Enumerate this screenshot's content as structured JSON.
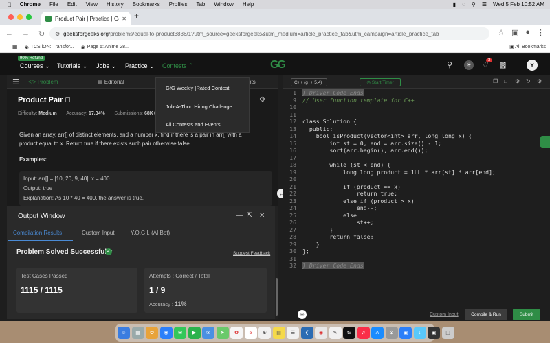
{
  "menubar": {
    "app": "Chrome",
    "items": [
      "File",
      "Edit",
      "View",
      "History",
      "Bookmarks",
      "Profiles",
      "Tab",
      "Window",
      "Help"
    ],
    "datetime": "Wed 5 Feb  10:52 AM"
  },
  "browser": {
    "tab_title": "Product Pair | Practice | Geek",
    "url_site": "geeksforgeeks.org",
    "url_rest": "/problems/equal-to-product3836/1?utm_source=geeksforgeeks&utm_medium=article_practice_tab&utm_campaign=article_practice_tab",
    "bookmarks": [
      {
        "label": "TCS iON: Transfor..."
      },
      {
        "label": "Page 5: Anime 28..."
      }
    ],
    "all_bookmarks": "All Bookmarks"
  },
  "gfg_nav": {
    "badge": "90% Refund",
    "items": [
      "Courses",
      "Tutorials",
      "Jobs",
      "Practice",
      "Contests"
    ],
    "logo_text": "GG",
    "notification_count": "3",
    "avatar_initial": "Y"
  },
  "problem_tabs": {
    "problem": "</> Problem",
    "editorial": "Editorial",
    "comments": "ments"
  },
  "problem": {
    "title": "Product Pair",
    "difficulty_label": "Difficulty:",
    "difficulty": "Medium",
    "accuracy_label": "Accuracy:",
    "accuracy": "17.34%",
    "submissions_label": "Submissions:",
    "submissions": "68K+",
    "desc_line1": "Given an array, arr[] of distinct elements, and a number x, find if there is a pair in arr[] with a",
    "desc_line2": "product equal to x. Return true if there exists such pair otherwise false.",
    "examples_heading": "Examples:",
    "example_input": "Input:  arr[] = [10, 20, 9, 40], x = 400",
    "example_output": "Output:  true",
    "example_explanation": "Explanation:  As 10 * 40 = 400, the answer is true."
  },
  "contests_dropdown": [
    "GfG Weekly [Rated Contest]",
    "Job-A-Thon Hiring Challenge",
    "All Contests and Events"
  ],
  "output": {
    "title": "Output Window",
    "tabs": [
      "Compilation Results",
      "Custom Input",
      "Y.O.G.I. (AI Bot)"
    ],
    "status": "Problem Solved Successfully",
    "suggest_feedback": "Suggest Feedback",
    "test_cases_label": "Test Cases Passed",
    "test_cases_value": "1115 / 1115",
    "attempts_label": "Attempts : Correct / Total",
    "attempts_value": "1 / 9",
    "accuracy_label": "Accuracy :",
    "accuracy_value": "11%"
  },
  "editor": {
    "language": "C++ (g++ 5.4)",
    "start_timer": "Start Timer",
    "lines": [
      {
        "n": "1",
        "t": "} Driver Code Ends"
      },
      {
        "n": "9",
        "t": "// User function template for C++"
      },
      {
        "n": "10",
        "t": ""
      },
      {
        "n": "11",
        "t": ""
      },
      {
        "n": "12",
        "t": "class Solution {"
      },
      {
        "n": "13",
        "t": "  public:"
      },
      {
        "n": "14",
        "t": "    bool isProduct(vector<int> arr, long long x) {"
      },
      {
        "n": "15",
        "t": "        int st = 0, end = arr.size() - 1;"
      },
      {
        "n": "16",
        "t": "        sort(arr.begin(), arr.end());"
      },
      {
        "n": "17",
        "t": ""
      },
      {
        "n": "18",
        "t": "        while (st < end) {"
      },
      {
        "n": "19",
        "t": "            long long product = 1LL * arr[st] * arr[end];"
      },
      {
        "n": "20",
        "t": ""
      },
      {
        "n": "21",
        "t": "            if (product == x)"
      },
      {
        "n": "22",
        "t": "                return true;"
      },
      {
        "n": "23",
        "t": "            else if (product > x)"
      },
      {
        "n": "24",
        "t": "                end--;"
      },
      {
        "n": "25",
        "t": "            else"
      },
      {
        "n": "26",
        "t": "                st++;"
      },
      {
        "n": "27",
        "t": "        }"
      },
      {
        "n": "28",
        "t": "        return false;"
      },
      {
        "n": "29",
        "t": "    }"
      },
      {
        "n": "30",
        "t": "};"
      },
      {
        "n": "31",
        "t": ""
      },
      {
        "n": "32",
        "t": "} Driver Code Ends"
      }
    ],
    "custom_input": "Custom Input",
    "compile_run": "Compile & Run",
    "submit": "Submit"
  },
  "colors": {
    "brand": "#2f8d46",
    "link": "#4a8ad4",
    "bg": "#1e1e1e"
  }
}
